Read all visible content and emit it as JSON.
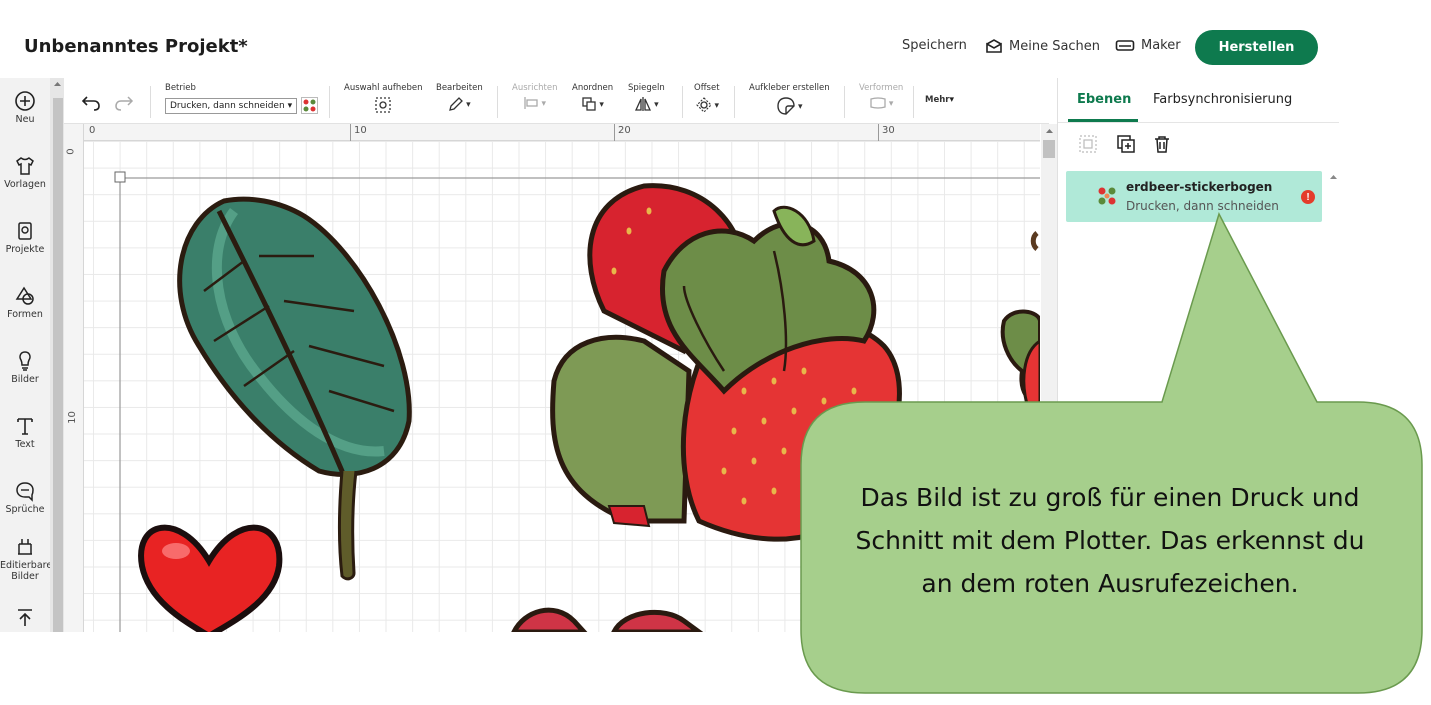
{
  "header": {
    "project_title": "Unbenanntes Projekt*",
    "save_label": "Speichern",
    "my_stuff_label": "Meine Sachen",
    "maker_label": "Maker",
    "make_label": "Herstellen",
    "make_color": "#0e7a4e"
  },
  "sidebar": {
    "items": [
      {
        "label": "Neu",
        "icon": "plus-circle-icon"
      },
      {
        "label": "Vorlagen",
        "icon": "shirt-icon"
      },
      {
        "label": "Projekte",
        "icon": "projects-icon"
      },
      {
        "label": "Formen",
        "icon": "shapes-icon"
      },
      {
        "label": "Bilder",
        "icon": "lightbulb-icon"
      },
      {
        "label": "Text",
        "icon": "text-icon"
      },
      {
        "label": "Sprüche",
        "icon": "speech-bubble-icon"
      },
      {
        "label": "Editierbare Bilder",
        "icon": "editable-images-icon"
      },
      {
        "label": "",
        "icon": "upload-icon"
      }
    ]
  },
  "toolbar": {
    "operation_label": "Betrieb",
    "operation_value": "Drucken, dann schneiden",
    "deselect_label": "Auswahl aufheben",
    "edit_label": "Bearbeiten",
    "align_label": "Ausrichten",
    "arrange_label": "Anordnen",
    "flip_label": "Spiegeln",
    "offset_label": "Offset",
    "sticker_label": "Aufkleber erstellen",
    "warp_label": "Verformen",
    "more_label": "Mehr"
  },
  "rulers": {
    "top": [
      "0",
      "10",
      "20",
      "30"
    ],
    "left": [
      "0",
      "10"
    ]
  },
  "panel": {
    "tab_layers": "Ebenen",
    "tab_color_sync": "Farbsynchronisierung",
    "layer": {
      "name": "erdbeer-stickerbogen",
      "operation": "Drucken, dann schneiden",
      "warning": "!"
    }
  },
  "callout": {
    "text_lines": [
      "Das Bild ist zu groß für einen Druck und",
      "Schnitt mit dem Plotter. Das erkennst du",
      "an dem roten Ausrufezeichen."
    ],
    "fill": "#a6cf8c",
    "border": "#6a9a4e"
  }
}
